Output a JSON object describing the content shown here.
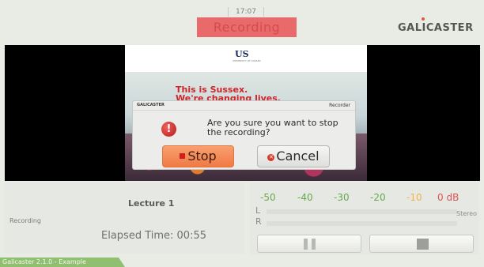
{
  "header": {
    "clock": "17:07",
    "recording_banner": "Recording",
    "brand": "GALICASTER"
  },
  "preview": {
    "logo": "US",
    "logo_sub": "UNIVERSITY OF SUSSEX",
    "headline_1": "This is Sussex.",
    "headline_2": "We're changing lives."
  },
  "dialog": {
    "brand": "GALICASTER",
    "title": "Recorder",
    "message": "Are you sure you want to stop the recording?",
    "stop_label": "Stop",
    "cancel_label": "Cancel",
    "icon": "error-icon"
  },
  "info": {
    "lecture_title": "Lecture 1",
    "status": "Recording",
    "elapsed": "Elapsed Time: 00:55"
  },
  "audio": {
    "scale": [
      {
        "label": "-50",
        "color": "#6aa84f"
      },
      {
        "label": "-40",
        "color": "#6aa84f"
      },
      {
        "label": "-30",
        "color": "#6aa84f"
      },
      {
        "label": "-20",
        "color": "#6aa84f"
      },
      {
        "label": "-10",
        "color": "#f2b24a"
      },
      {
        "label": "0 dB",
        "color": "#e05252"
      }
    ],
    "left_label": "L",
    "right_label": "R",
    "mode": "Stereo"
  },
  "controls": {
    "pause_icon": "pause-icon",
    "stop_icon": "stop-icon"
  },
  "footer": {
    "text": "Galicaster 2.1.0 - Example"
  },
  "colors": {
    "recording_red": "#e96a6a",
    "footer_green": "#8fbf6f",
    "stop_orange": "#f07a44"
  }
}
